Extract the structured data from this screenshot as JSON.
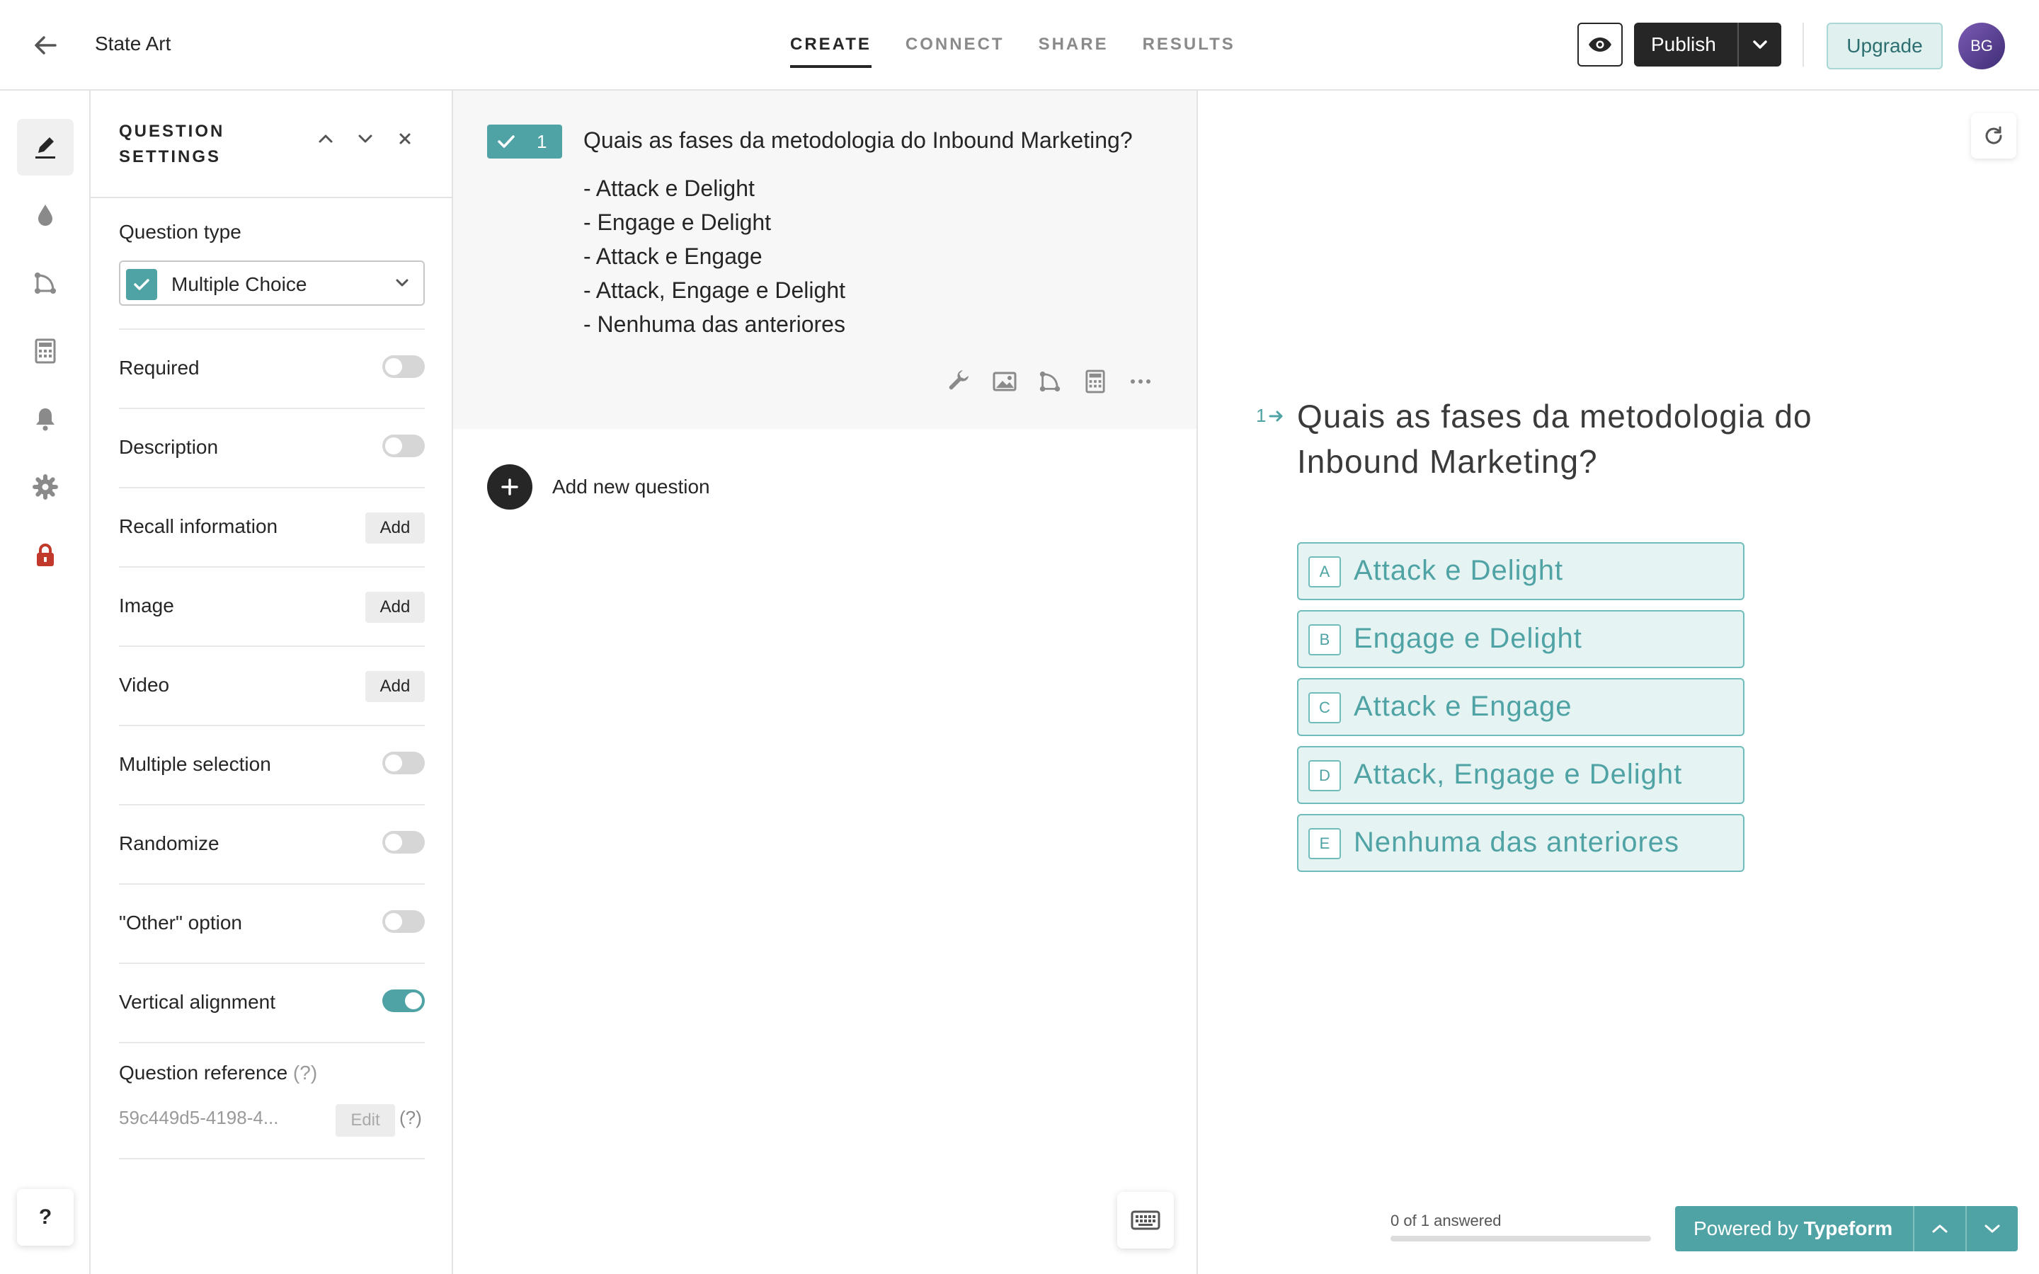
{
  "header": {
    "form_title": "State Art",
    "tabs": [
      {
        "label": "CREATE",
        "active": true
      },
      {
        "label": "CONNECT",
        "active": false
      },
      {
        "label": "SHARE",
        "active": false
      },
      {
        "label": "RESULTS",
        "active": false
      }
    ],
    "publish_label": "Publish",
    "upgrade_label": "Upgrade",
    "avatar_initials": "BG"
  },
  "sidebar": {
    "items": [
      {
        "icon": "pen-icon",
        "active": true
      },
      {
        "icon": "drop-icon",
        "active": false
      },
      {
        "icon": "logic-icon",
        "active": false
      },
      {
        "icon": "calculator-icon",
        "active": false
      },
      {
        "icon": "bell-icon",
        "active": false
      },
      {
        "icon": "gear-icon",
        "active": false
      },
      {
        "icon": "lock-icon",
        "active": false
      }
    ],
    "help_label": "?"
  },
  "settings": {
    "title": "QUESTION SETTINGS",
    "question_type_label": "Question type",
    "question_type_value": "Multiple Choice",
    "rows": [
      {
        "label": "Required",
        "control": "toggle",
        "on": false
      },
      {
        "label": "Description",
        "control": "toggle",
        "on": false
      },
      {
        "label": "Recall information",
        "control": "button",
        "button_label": "Add"
      },
      {
        "label": "Image",
        "control": "button",
        "button_label": "Add"
      },
      {
        "label": "Video",
        "control": "button",
        "button_label": "Add"
      },
      {
        "label": "Multiple selection",
        "control": "toggle",
        "on": false
      },
      {
        "label": "Randomize",
        "control": "toggle",
        "on": false
      },
      {
        "label": "\"Other\" option",
        "control": "toggle",
        "on": false
      },
      {
        "label": "Vertical alignment",
        "control": "toggle",
        "on": true
      }
    ],
    "reference_label": "Question reference",
    "reference_hint": "(?)",
    "reference_value": "59c449d5-4198-4...",
    "reference_edit_label": "Edit",
    "reference_help": "(?)"
  },
  "editor": {
    "question_number": "1",
    "question_text": "Quais as fases da metodologia do Inbound Marketing?",
    "options": [
      "- Attack e Delight",
      "- Engage e Delight",
      "- Attack e Engage",
      "- Attack, Engage e Delight",
      "- Nenhuma das anteriores"
    ],
    "add_question_label": "Add new question"
  },
  "preview": {
    "question_number": "1",
    "question_text": "Quais as fases da metodologia do Inbound Marketing?",
    "choices": [
      {
        "key": "A",
        "label": "Attack e Delight"
      },
      {
        "key": "B",
        "label": "Engage e Delight"
      },
      {
        "key": "C",
        "label": "Attack e Engage"
      },
      {
        "key": "D",
        "label": "Attack, Engage e Delight"
      },
      {
        "key": "E",
        "label": "Nenhuma das anteriores"
      }
    ],
    "progress_text": "0 of 1 answered",
    "progress_fraction": 0,
    "powered_prefix": "Powered by",
    "powered_brand": "Typeform"
  },
  "colors": {
    "accent": "#4fa3a5",
    "dark": "#262627",
    "choice_bg": "#e5f3f2",
    "danger": "#c0392b"
  }
}
